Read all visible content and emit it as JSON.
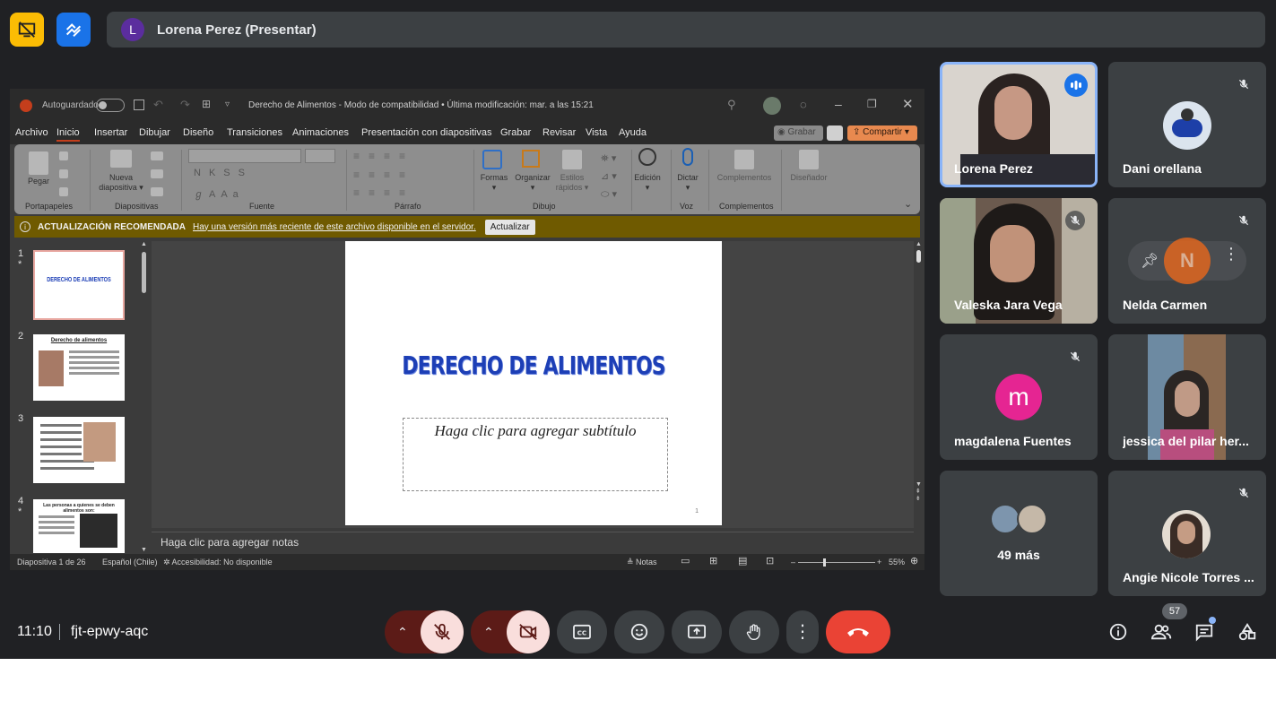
{
  "meet": {
    "presenter_initial": "L",
    "presenter_label": "Lorena Perez (Presentar)",
    "clock": "11:10",
    "meeting_code": "fjt-epwy-aqc",
    "participant_count": "57",
    "tiles": [
      {
        "name": "Lorena Perez",
        "speaking": true
      },
      {
        "name": "Dani orellana",
        "muted": true
      },
      {
        "name": "Valeska Jara Vega",
        "muted": true
      },
      {
        "name": "Nelda Carmen",
        "muted": true
      },
      {
        "name": "magdalena Fuentes",
        "initial": "m",
        "avatar_color": "#e52592",
        "muted": true
      },
      {
        "name": "jessica del pilar her..."
      },
      {
        "name": "49 más"
      },
      {
        "name": "Angie Nicole Torres ...",
        "muted": true
      }
    ],
    "colors": {
      "background": "#202124",
      "tile": "#3c4043",
      "end_call": "#ea4335",
      "muted_button": "#f9dedc",
      "speaking_border": "#8ab4f8"
    }
  },
  "ppt": {
    "autosave": "Autoguardado",
    "title": "Derecho de Alimentos  -  Modo de compatibilidad • Última modificación: mar. a las 15:21",
    "menu": [
      "Archivo",
      "Inicio",
      "Insertar",
      "Dibujar",
      "Diseño",
      "Transiciones",
      "Animaciones",
      "Presentación con diapositivas",
      "Grabar",
      "Revisar",
      "Vista",
      "Ayuda"
    ],
    "record_btn": "Grabar",
    "share_btn": "Compartir",
    "ribbon": {
      "pegar": "Pegar",
      "nueva": "Nueva",
      "diapositiva": "diapositiva",
      "formas": "Formas",
      "organizar": "Organizar",
      "estilos": "Estilos",
      "rapidos": "rápidos",
      "edicion": "Edición",
      "dictar": "Dictar",
      "complementos": "Complementos",
      "disenador": "Diseñador",
      "groups": [
        "Portapapeles",
        "Diapositivas",
        "Fuente",
        "Párrafo",
        "Dibujo",
        "Voz",
        "Complementos"
      ]
    },
    "update_bar": {
      "title": "ACTUALIZACIÓN RECOMENDADA",
      "message": "Hay una versión más reciente de este archivo disponible en el servidor.",
      "button": "Actualizar"
    },
    "thumbs": [
      {
        "num": "1",
        "star": "*",
        "text": "DERECHO DE ALIMENTOS"
      },
      {
        "num": "2",
        "star": "",
        "text": "Derecho de alimentos"
      },
      {
        "num": "3",
        "star": "",
        "text": ""
      },
      {
        "num": "4",
        "star": "*",
        "text": "Las personas a quienes se deben alimentos son:"
      }
    ],
    "slide": {
      "title": "DERECHO DE ALIMENTOS",
      "subtitle": "Haga clic para agregar subtítulo",
      "number": "1"
    },
    "notes": "Haga clic para agregar notas",
    "status": {
      "slide": "Diapositiva 1 de 26",
      "lang": "Español (Chile)",
      "access": "Accesibilidad: No disponible",
      "notes": "Notas",
      "zoom": "55%"
    }
  }
}
